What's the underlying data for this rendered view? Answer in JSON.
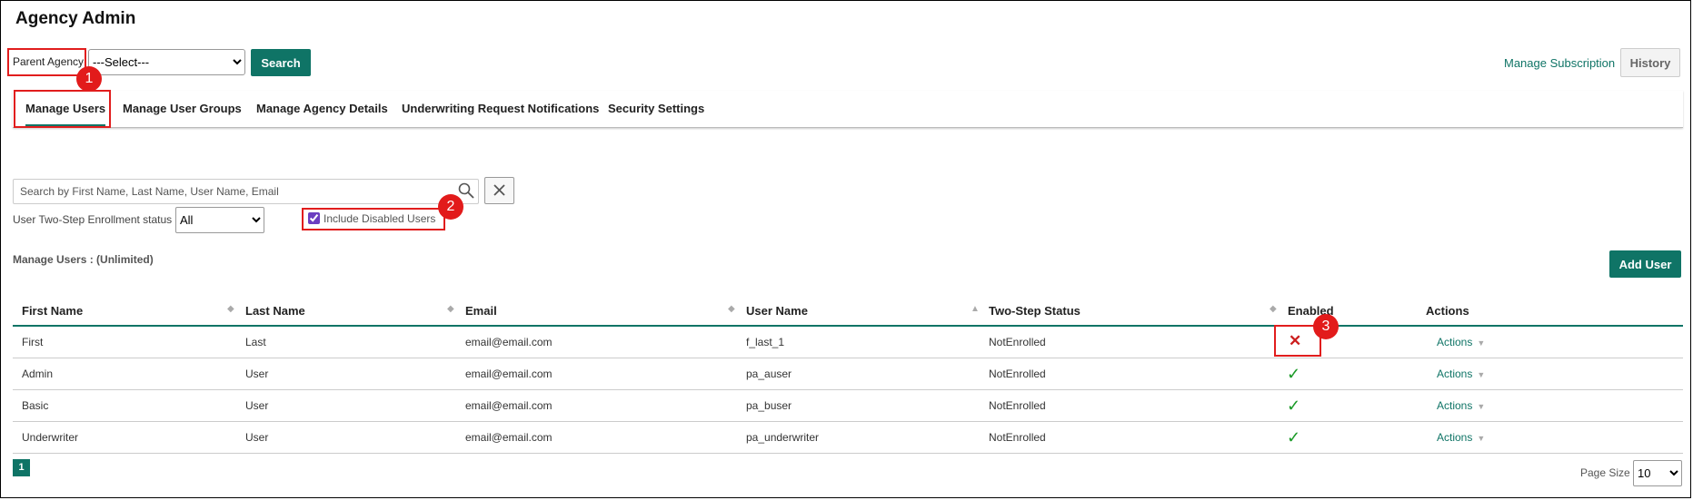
{
  "page_title": "Agency Admin",
  "parent_agency": {
    "label": "Parent Agency",
    "selected": "---Select---",
    "search_label": "Search"
  },
  "header_links": {
    "manage_subscription": "Manage Subscription",
    "history": "History"
  },
  "tabs": [
    {
      "label": "Manage Users",
      "active": true
    },
    {
      "label": "Manage User Groups"
    },
    {
      "label": "Manage Agency Details"
    },
    {
      "label": "Underwriting Request Notifications"
    },
    {
      "label": "Security Settings"
    }
  ],
  "search": {
    "placeholder": "Search by First Name, Last Name, User Name, Email",
    "clear_icon": "close-icon",
    "search_icon": "magnifier-icon"
  },
  "filters": {
    "enrollment_label": "User Two-Step Enrollment status",
    "enrollment_selected": "All",
    "include_disabled_label": "Include Disabled Users",
    "include_disabled_checked": true
  },
  "manage_users_label": "Manage Users : (Unlimited)",
  "add_user_label": "Add User",
  "table": {
    "columns": [
      "First Name",
      "Last Name",
      "Email",
      "User Name",
      "Two-Step Status",
      "Enabled",
      "Actions"
    ],
    "rows": [
      {
        "first": "First",
        "last": "Last",
        "email": "email@email.com",
        "username": "f_last_1",
        "status": "NotEnrolled",
        "enabled": false,
        "enabled_glyph": "✕",
        "action": "Actions"
      },
      {
        "first": "Admin",
        "last": "User",
        "email": "email@email.com",
        "username": "pa_auser",
        "status": "NotEnrolled",
        "enabled": true,
        "enabled_glyph": "✓",
        "action": "Actions"
      },
      {
        "first": "Basic",
        "last": "User",
        "email": "email@email.com",
        "username": "pa_buser",
        "status": "NotEnrolled",
        "enabled": true,
        "enabled_glyph": "✓",
        "action": "Actions"
      },
      {
        "first": "Underwriter",
        "last": "User",
        "email": "email@email.com",
        "username": "pa_underwriter",
        "status": "NotEnrolled",
        "enabled": true,
        "enabled_glyph": "✓",
        "action": "Actions"
      }
    ]
  },
  "pagination": {
    "current_page": "1",
    "page_size_label": "Page Size",
    "page_size": "10"
  },
  "annotations": {
    "badge1": "1",
    "badge2": "2",
    "badge3": "3"
  },
  "colors": {
    "primary": "#0f7466",
    "annotation": "#e21b1b",
    "enabled_check": "#1a9a27",
    "disabled_x": "#cc1e1e"
  }
}
